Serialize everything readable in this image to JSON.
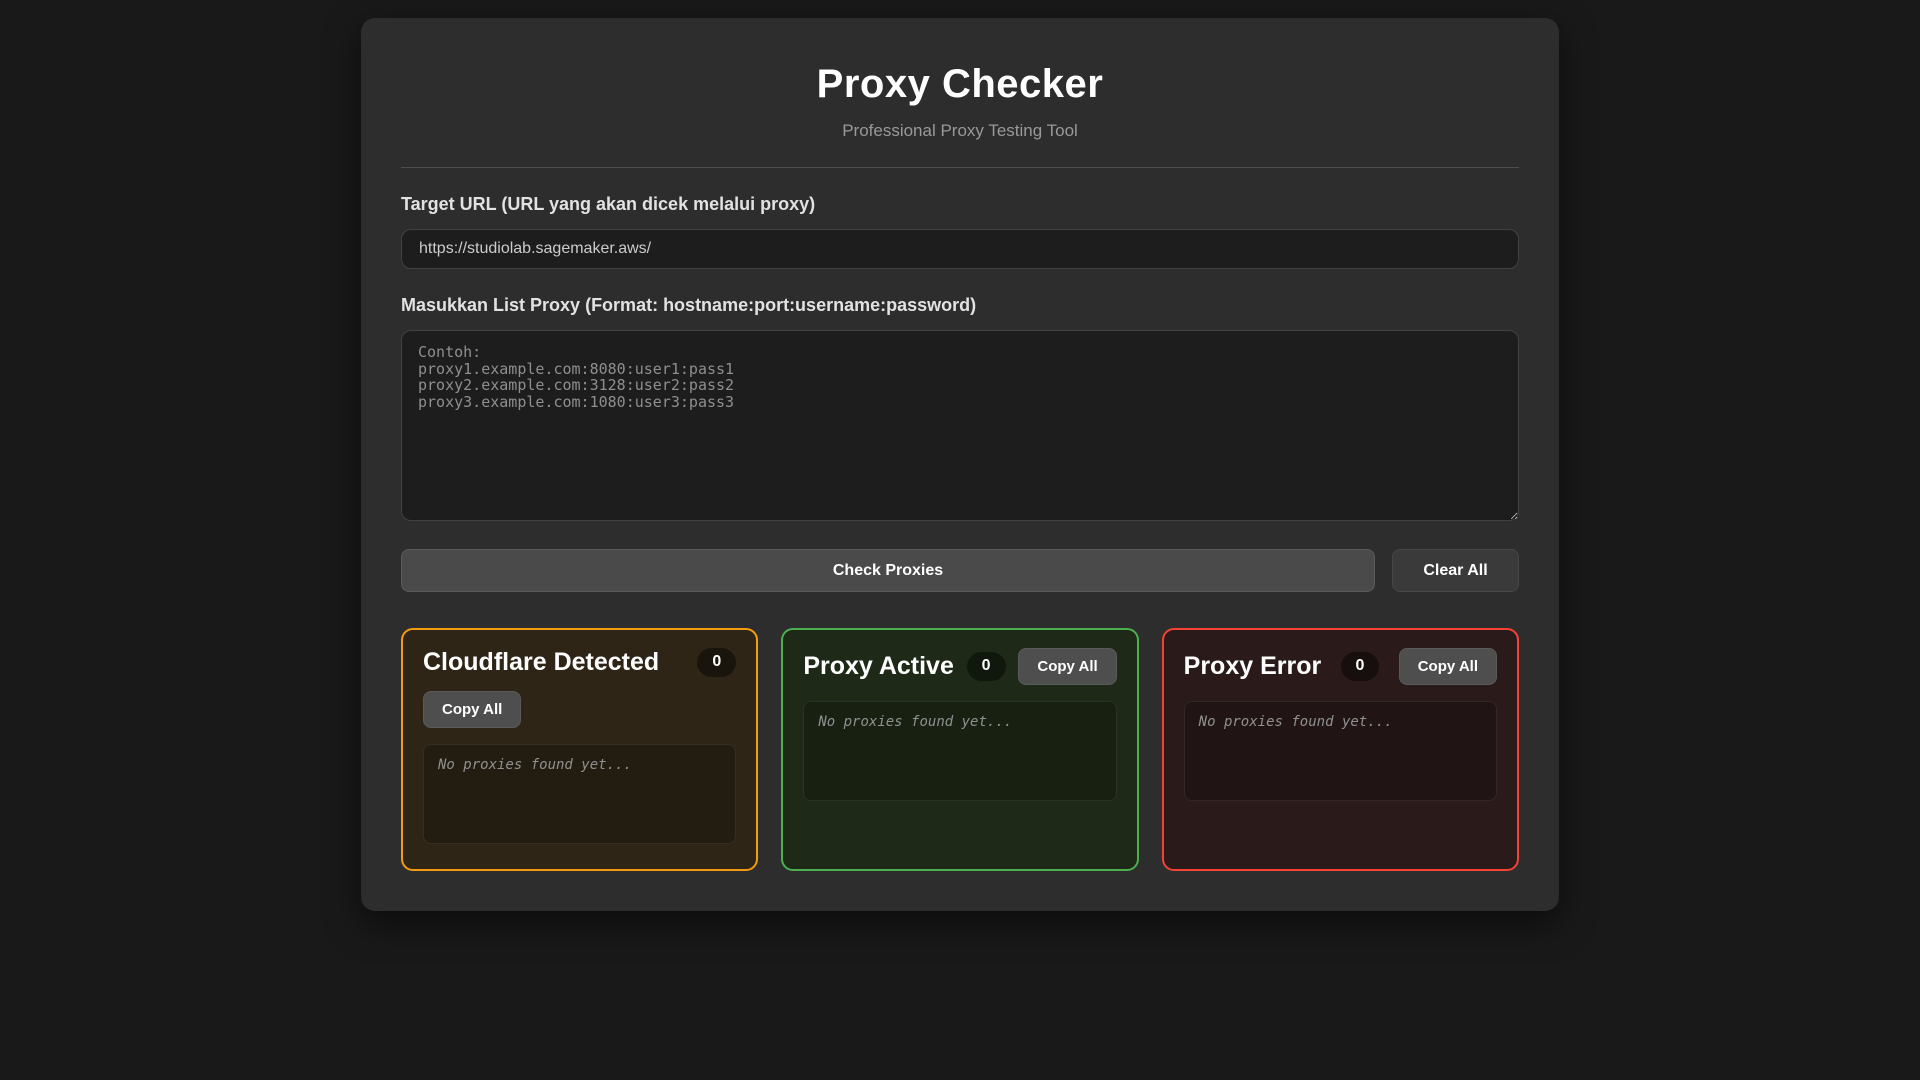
{
  "header": {
    "title": "Proxy Checker",
    "subtitle": "Professional Proxy Testing Tool"
  },
  "form": {
    "target_url_label": "Target URL (URL yang akan dicek melalui proxy)",
    "target_url_value": "https://studiolab.sagemaker.aws/",
    "proxy_list_label": "Masukkan List Proxy (Format: hostname:port:username:password)",
    "proxy_list_placeholder": "Contoh:\nproxy1.example.com:8080:user1:pass1\nproxy2.example.com:3128:user2:pass2\nproxy3.example.com:1080:user3:pass3"
  },
  "actions": {
    "check_label": "Check Proxies",
    "clear_label": "Clear All"
  },
  "results": {
    "copy_all_label": "Copy All",
    "empty_placeholder": "No proxies found yet...",
    "cards": [
      {
        "title": "Cloudflare Detected",
        "count": "0",
        "accent": "#f39c12"
      },
      {
        "title": "Proxy Active",
        "count": "0",
        "accent": "#4caf50"
      },
      {
        "title": "Proxy Error",
        "count": "0",
        "accent": "#f44336"
      }
    ]
  },
  "colors": {
    "page_background": "#191919",
    "panel_background": "#2d2d2d",
    "input_background": "#1d1d1d",
    "button_gray": "#4a4a4a"
  }
}
